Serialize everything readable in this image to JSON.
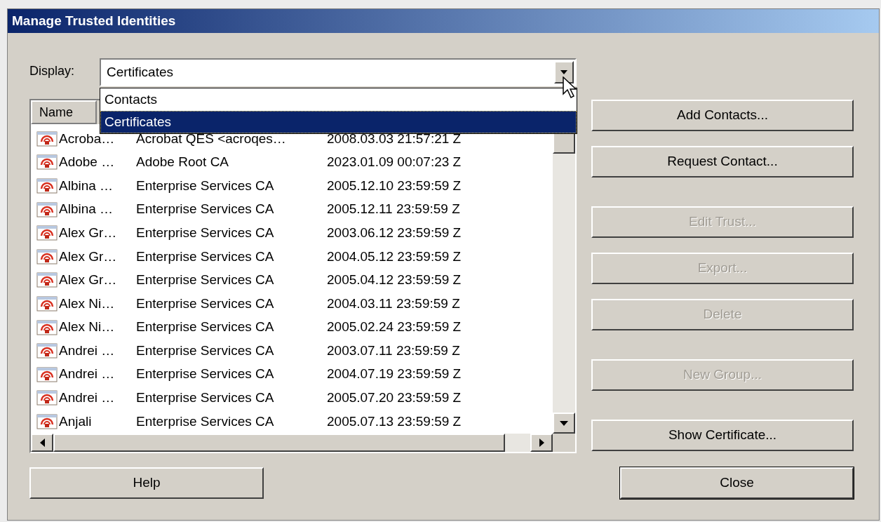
{
  "window": {
    "title": "Manage Trusted Identities"
  },
  "display": {
    "label": "Display:",
    "value": "Certificates",
    "options": [
      {
        "label": "Contacts",
        "selected": false
      },
      {
        "label": "Certificates",
        "selected": true
      }
    ]
  },
  "table": {
    "columns": [
      "Name"
    ],
    "rows": [
      {
        "name": "Acroba…",
        "issuer": "Acrobat QES <acroqes…",
        "expires": "2008.03.03 21:57:21 Z"
      },
      {
        "name": "Adobe …",
        "issuer": "Adobe Root CA",
        "expires": "2023.01.09 00:07:23 Z"
      },
      {
        "name": "Albina …",
        "issuer": "Enterprise Services CA",
        "expires": "2005.12.10 23:59:59 Z"
      },
      {
        "name": "Albina …",
        "issuer": "Enterprise Services CA",
        "expires": "2005.12.11 23:59:59 Z"
      },
      {
        "name": "Alex Gr…",
        "issuer": "Enterprise Services CA",
        "expires": "2003.06.12 23:59:59 Z"
      },
      {
        "name": "Alex Gr…",
        "issuer": "Enterprise Services CA",
        "expires": "2004.05.12 23:59:59 Z"
      },
      {
        "name": "Alex Gr…",
        "issuer": "Enterprise Services CA",
        "expires": "2005.04.12 23:59:59 Z"
      },
      {
        "name": "Alex Ni…",
        "issuer": "Enterprise Services CA",
        "expires": "2004.03.11 23:59:59 Z"
      },
      {
        "name": "Alex Ni…",
        "issuer": "Enterprise Services CA",
        "expires": "2005.02.24 23:59:59 Z"
      },
      {
        "name": "Andrei …",
        "issuer": "Enterprise Services CA",
        "expires": "2003.07.11 23:59:59 Z"
      },
      {
        "name": "Andrei …",
        "issuer": "Enterprise Services CA",
        "expires": "2004.07.19 23:59:59 Z"
      },
      {
        "name": "Andrei …",
        "issuer": "Enterprise Services CA",
        "expires": "2005.07.20 23:59:59 Z"
      },
      {
        "name": "Anjali",
        "issuer": "Enterprise Services CA",
        "expires": "2005.07.13 23:59:59 Z"
      }
    ]
  },
  "button_groups": [
    [
      {
        "label": "Add Contacts...",
        "disabled": false
      },
      {
        "label": "Request Contact...",
        "disabled": false
      }
    ],
    [
      {
        "label": "Edit Trust...",
        "disabled": true
      },
      {
        "label": "Export...",
        "disabled": true
      },
      {
        "label": "Delete",
        "disabled": true
      }
    ],
    [
      {
        "label": "New Group...",
        "disabled": true
      }
    ],
    [
      {
        "label": "Show Certificate...",
        "disabled": false
      }
    ]
  ],
  "footer_buttons": [
    {
      "label": "Help",
      "default": false
    },
    {
      "label": "Close",
      "default": true
    }
  ]
}
